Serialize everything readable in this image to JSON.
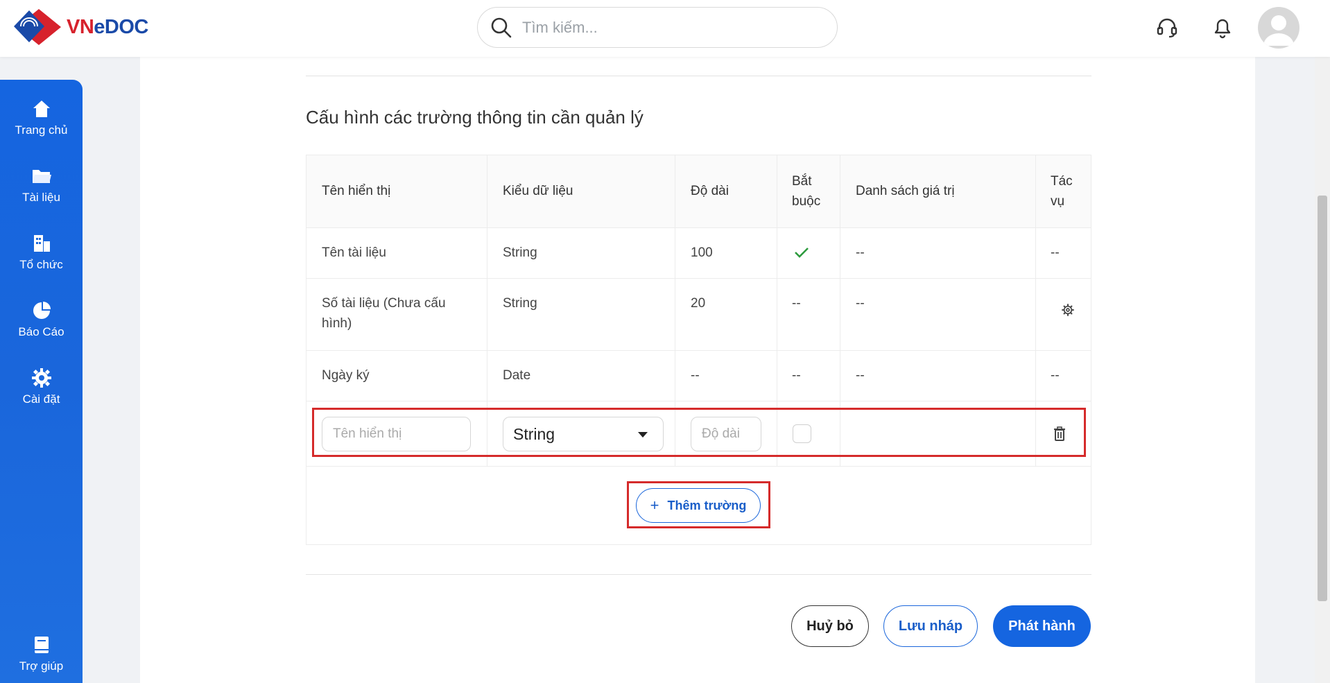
{
  "app": {
    "brand_vn": "VN",
    "brand_doc": "eDOC"
  },
  "search": {
    "placeholder": "Tìm kiếm..."
  },
  "sidebar": {
    "items": [
      {
        "label": "Trang chủ",
        "icon": "home-icon"
      },
      {
        "label": "Tài liệu",
        "icon": "folder-icon"
      },
      {
        "label": "Tổ chức",
        "icon": "building-icon"
      },
      {
        "label": "Báo Cáo",
        "icon": "pie-chart-icon"
      },
      {
        "label": "Cài đặt",
        "icon": "gear-icon"
      }
    ],
    "help": {
      "label": "Trợ giúp",
      "icon": "book-icon"
    }
  },
  "section": {
    "title": "Cấu hình các trường thông tin cần quản lý"
  },
  "table": {
    "headers": [
      "Tên hiển thị",
      "Kiểu dữ liệu",
      "Độ dài",
      "Bắt buộc",
      "Danh sách giá trị",
      "Tác vụ"
    ],
    "rows": [
      {
        "name": "Tên tài liệu",
        "type": "String",
        "length": "100",
        "required": "check",
        "values": "--",
        "action": "--"
      },
      {
        "name": "Số tài liệu (Chưa cấu hình)",
        "type": "String",
        "length": "20",
        "required": "--",
        "values": "--",
        "action": "settings-icon"
      },
      {
        "name": "Ngày ký",
        "type": "Date",
        "length": "--",
        "required": "--",
        "values": "--",
        "action": "--"
      }
    ],
    "new_row": {
      "name_placeholder": "Tên hiển thị",
      "type_value": "String",
      "length_placeholder": "Độ dài"
    }
  },
  "add_field": {
    "label": "Thêm trường"
  },
  "footer": {
    "cancel_label": "Huỷ bỏ",
    "draft_label": "Lưu nháp",
    "publish_label": "Phát hành"
  },
  "colors": {
    "primary": "#1565e0",
    "highlight": "#d52b2b",
    "success": "#2e9b3e"
  }
}
